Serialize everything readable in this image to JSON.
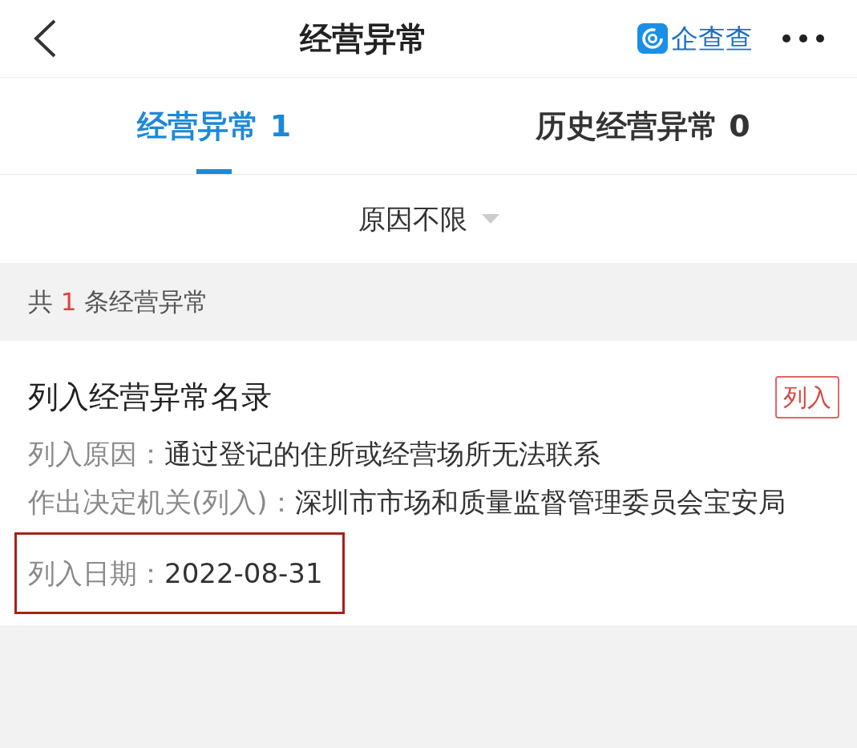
{
  "header": {
    "title": "经营异常",
    "logo_text": "企查查"
  },
  "tabs": [
    {
      "label": "经营异常 1",
      "selected": true
    },
    {
      "label": "历史经营异常 0",
      "selected": false
    }
  ],
  "filter": {
    "label": "原因不限"
  },
  "summary": {
    "prefix": "共",
    "count": "1",
    "suffix": "条经营异常"
  },
  "record": {
    "title": "列入经营异常名录",
    "badge": "列入",
    "fields": [
      {
        "label": "列入原因：",
        "value": "通过登记的住所或经营场所无法联系",
        "highlighted": false
      },
      {
        "label": "作出决定机关(列入)：",
        "value": "深圳市市场和质量监督管理委员会宝安局",
        "highlighted": false
      },
      {
        "label": "列入日期：",
        "value": "2022-08-31",
        "highlighted": true
      }
    ]
  }
}
